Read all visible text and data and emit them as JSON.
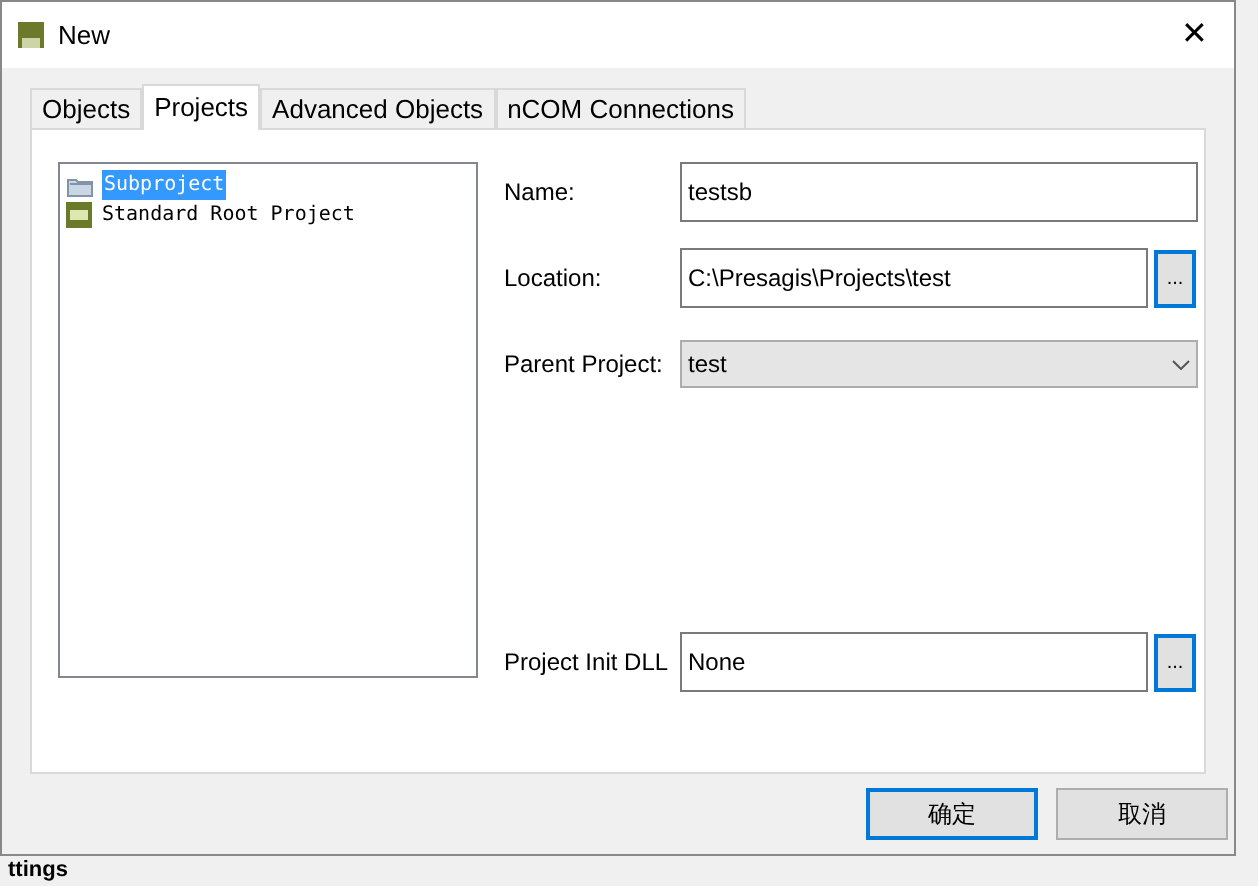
{
  "window": {
    "title": "New",
    "close": "✕"
  },
  "tabs": [
    {
      "label": "Objects",
      "selected": false
    },
    {
      "label": "Projects",
      "selected": true
    },
    {
      "label": "Advanced Objects",
      "selected": false
    },
    {
      "label": "nCOM Connections",
      "selected": false
    }
  ],
  "project_types": [
    {
      "label": "Subproject",
      "kind": "subproject",
      "selected": true
    },
    {
      "label": "Standard Root Project",
      "kind": "root",
      "selected": false
    }
  ],
  "fields": [
    {
      "label": "Name:",
      "kind": "text",
      "value": "testsb"
    },
    {
      "label": "Location:",
      "kind": "browse",
      "value": "C:\\Presagis\\Projects\\test",
      "browse": "..."
    },
    {
      "label": "Parent Project:",
      "kind": "dropdown",
      "value": "test"
    },
    {
      "label": "Project Init DLL",
      "kind": "browse",
      "value": "None",
      "browse": "..."
    }
  ],
  "buttons": [
    {
      "label": "确定",
      "default": true
    },
    {
      "label": "取消",
      "default": false
    }
  ],
  "background_text": "ttings"
}
